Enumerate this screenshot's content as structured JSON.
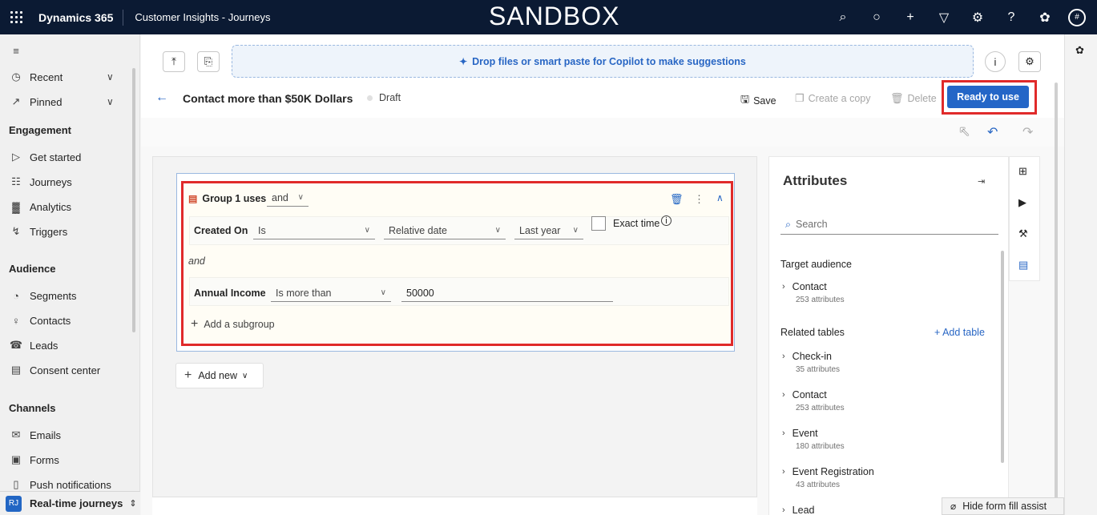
{
  "topbar": {
    "app_name": "Dynamics 365",
    "area_name": "Customer Insights - Journeys",
    "environment": "SANDBOX",
    "icons": [
      "search-icon",
      "lightbulb-icon",
      "plus-icon",
      "filter-icon",
      "settings-icon",
      "help-icon",
      "copilot-icon"
    ],
    "avatar_glyph": "#"
  },
  "sidebar": {
    "recent": "Recent",
    "pinned": "Pinned",
    "sections": [
      {
        "title": "Engagement",
        "items": [
          "Get started",
          "Journeys",
          "Analytics",
          "Triggers"
        ]
      },
      {
        "title": "Audience",
        "items": [
          "Segments",
          "Contacts",
          "Leads",
          "Consent center"
        ]
      },
      {
        "title": "Channels",
        "items": [
          "Emails",
          "Forms",
          "Push notifications"
        ]
      }
    ],
    "area_switcher": {
      "initials": "RJ",
      "label": "Real-time journeys"
    }
  },
  "command": {
    "dropzone_text": "Drop files or smart paste for Copilot to make suggestions"
  },
  "header": {
    "title": "Contact more than $50K Dollars",
    "status": "Draft",
    "save": "Save",
    "create_copy": "Create a copy",
    "delete": "Delete",
    "ready": "Ready to use"
  },
  "group": {
    "label": "Group 1 uses",
    "operator": "and",
    "conditions": [
      {
        "attribute": "Created On",
        "operator": "Is",
        "type": "Relative date",
        "value": "Last year",
        "exact_time_label": "Exact time"
      },
      {
        "attribute": "Annual Income",
        "operator": "Is more than",
        "value": "50000"
      }
    ],
    "joiner": "and",
    "add_subgroup": "Add a subgroup"
  },
  "add_new": "Add new",
  "attributes": {
    "title": "Attributes",
    "search_placeholder": "Search",
    "target_audience": "Target audience",
    "target_items": [
      {
        "name": "Contact",
        "count": "253 attributes"
      }
    ],
    "related_tables": "Related tables",
    "add_table": "+ Add table",
    "related_items": [
      {
        "name": "Check-in",
        "count": "35 attributes"
      },
      {
        "name": "Contact",
        "count": "253 attributes"
      },
      {
        "name": "Event",
        "count": "180 attributes"
      },
      {
        "name": "Event Registration",
        "count": "43 attributes"
      },
      {
        "name": "Lead",
        "count": ""
      }
    ]
  },
  "hide_assist": "Hide form fill assist",
  "colors": {
    "topbar": "#0b1a33",
    "primary": "#2466c7",
    "highlight": "#e02a2a"
  }
}
